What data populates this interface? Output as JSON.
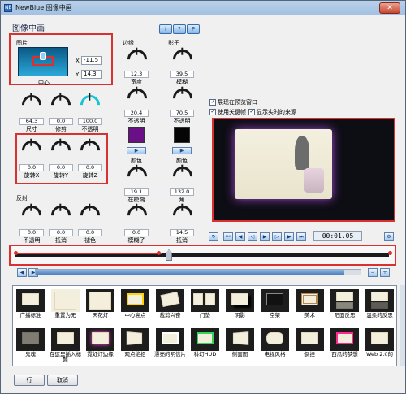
{
  "window": {
    "title": "NewBlue 图像中画",
    "app_icon": "NB"
  },
  "heading": "图像中画",
  "picture": {
    "label": "图片",
    "x_label": "X",
    "x_value": "-11.5",
    "y_label": "Y",
    "y_value": "14.3",
    "center_label": "中心"
  },
  "knobs_left": [
    {
      "value": "64.3",
      "label": "尺寸"
    },
    {
      "value": "0.0",
      "label": "修剪"
    },
    {
      "value": "100.0",
      "label": "不透明"
    }
  ],
  "rotation_knobs": [
    {
      "value": "0.0",
      "label": "旋转X"
    },
    {
      "value": "0.0",
      "label": "旋转Y"
    },
    {
      "value": "0.0",
      "label": "旋转Z"
    }
  ],
  "reflection": {
    "label": "反射",
    "knobs": [
      {
        "value": "0.0",
        "label": "不透明"
      },
      {
        "value": "0.0",
        "label": "抵消"
      },
      {
        "value": "0.0",
        "label": "褪色"
      }
    ]
  },
  "border": {
    "label": "边缘",
    "knobs": [
      {
        "value": "12.3",
        "label": "宽度"
      },
      {
        "value": "20.4",
        "label": "不透明"
      },
      {
        "value": "19.1",
        "label": "在模糊"
      },
      {
        "value": "0.0",
        "label": "模糊了"
      }
    ],
    "color_label": "颜色",
    "color": "#6a0f86"
  },
  "shadow": {
    "label": "影子",
    "knobs": [
      {
        "value": "39.5",
        "label": "模糊"
      },
      {
        "value": "70.5",
        "label": "不透明"
      },
      {
        "value": "132.0",
        "label": "角"
      },
      {
        "value": "14.5",
        "label": "抵消"
      }
    ],
    "color_label": "颜色",
    "color": "#050505"
  },
  "top_buttons": [
    "i",
    "?",
    "P"
  ],
  "options": [
    {
      "label": "展现在预览窗口",
      "checked": true
    },
    {
      "label": "使用关键帧",
      "checked": true
    },
    {
      "label": "显示实时的来源",
      "checked": true
    }
  ],
  "playback": {
    "time": "00:01.05"
  },
  "timeline": {
    "progress": 0.4
  },
  "gallery": [
    "广播标准",
    "重置为无",
    "天花灯",
    "中心高点",
    "裁剪兴奋",
    "门垫",
    "阴影",
    "空架",
    "美术",
    "阳面反思",
    "温柔的反思",
    "鬼魂",
    "在这里插入标题",
    "霓虹灯边缘",
    "观点绝招",
    "漂亮的明信片",
    "科幻HUD",
    "侧面图",
    "电视风格",
    "倒挂",
    "西瓜的梦想",
    "Web 2.0的"
  ],
  "buttons": {
    "ok": "行",
    "cancel": "取消"
  },
  "colors": {
    "accent_red": "#d93030",
    "knob_cyan": "#18c3d3"
  }
}
